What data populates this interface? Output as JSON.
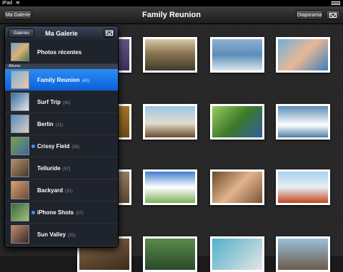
{
  "status_bar": {
    "carrier": "iPad",
    "wifi_icon": "wifi-icon",
    "battery_icon": "battery-icon"
  },
  "toolbar": {
    "left_button": "Ma Galerie",
    "title": "Family Reunion",
    "slideshow_button": "Diaporama",
    "share_icon": "mail-icon"
  },
  "popover": {
    "back_button": "Galeries",
    "title": "Ma Galerie",
    "share_icon": "mail-icon",
    "recent_label": "Photos récentes",
    "section_label": "Albums",
    "albums": [
      {
        "label": "Family Reunion",
        "count": "(40)",
        "selected": true,
        "dot": false
      },
      {
        "label": "Surf Trip",
        "count": "(41)",
        "selected": false,
        "dot": false
      },
      {
        "label": "Berlin",
        "count": "(11)",
        "selected": false,
        "dot": false
      },
      {
        "label": "Crissy Field",
        "count": "(26)",
        "selected": false,
        "dot": true
      },
      {
        "label": "Telluride",
        "count": "(57)",
        "selected": false,
        "dot": false
      },
      {
        "label": "Backyard",
        "count": "(31)",
        "selected": false,
        "dot": false
      },
      {
        "label": "iPhone Shots",
        "count": "(57)",
        "selected": false,
        "dot": true
      },
      {
        "label": "Sun Valley",
        "count": "(31)",
        "selected": false,
        "dot": false
      }
    ]
  }
}
